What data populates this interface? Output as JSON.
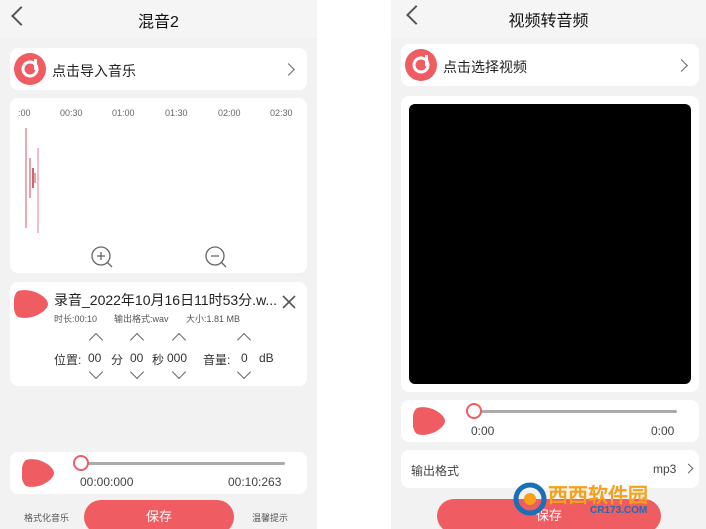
{
  "mix_screen": {
    "title": "混音2",
    "import_label": "点击导入音乐",
    "timeline_ticks": [
      ":00",
      "00:30",
      "01:00",
      "01:30",
      "02:00",
      "02:30"
    ],
    "track": {
      "name": "录音_2022年10月16日11时53分.w...",
      "duration": "时长:00:10",
      "format": "输出格式:wav",
      "size": "大小:1.81 MB",
      "position_label": "位置:",
      "minute_value": "00",
      "minute_label": "分",
      "second_value": "00",
      "second_label": "秒",
      "ms_value": "000",
      "volume_label": "音量:",
      "volume_value": "0",
      "volume_unit": "dB"
    },
    "player": {
      "current": "00:00:000",
      "total": "00:10:263",
      "progress": 0.0
    },
    "bottom": {
      "left_link": "格式化音乐",
      "save": "保存",
      "right_link": "温馨提示"
    }
  },
  "video_screen": {
    "title": "视频转音频",
    "select_label": "点击选择视频",
    "player": {
      "current": "0:00",
      "total": "0:00",
      "progress": 0.0
    },
    "output_label": "输出格式",
    "output_value": "mp3",
    "save": "保存"
  },
  "watermark": {
    "text": "西西软件园",
    "sub": "CR173.COM"
  },
  "colors": {
    "accent": "#ef5c62",
    "background": "#f2f2f2",
    "card": "#ffffff",
    "video_area": "#000000"
  }
}
